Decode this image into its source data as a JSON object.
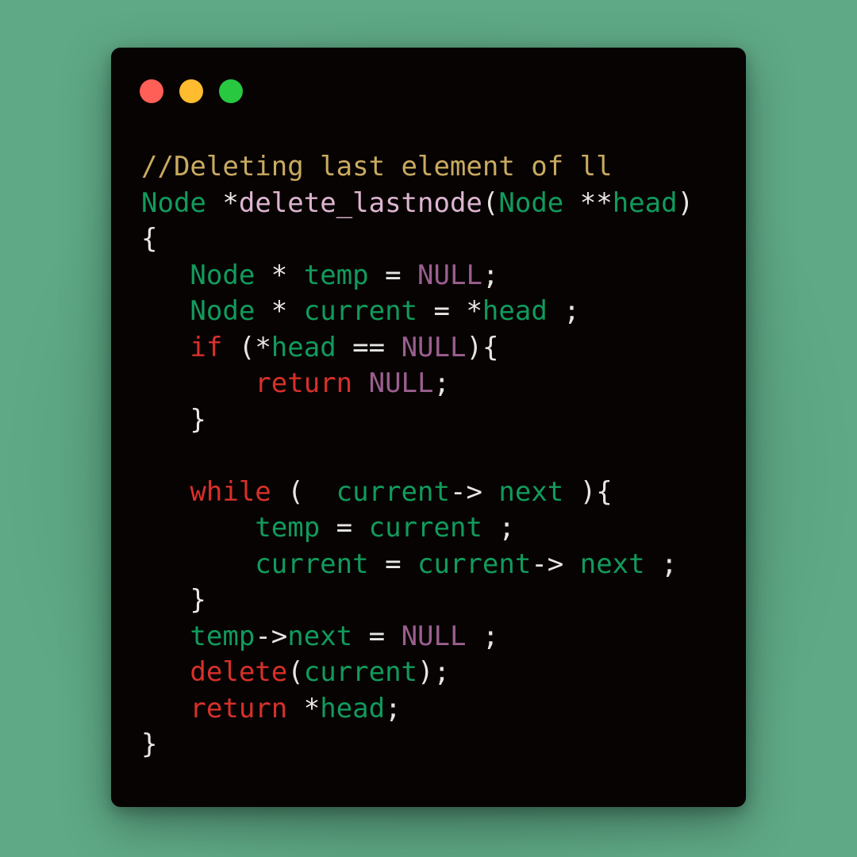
{
  "window": {
    "controls": [
      {
        "name": "close",
        "color": "#ff5f57"
      },
      {
        "name": "minimize",
        "color": "#febc2e"
      },
      {
        "name": "maximize",
        "color": "#28c840"
      }
    ]
  },
  "colors": {
    "background": "#5fa986",
    "editor_bg": "#070303",
    "comment": "#c9aa60",
    "type": "#119b5c",
    "function": "#ddb5d0",
    "keyword": "#d8302a",
    "null": "#9a5f8e",
    "default": "#e8e6e3"
  },
  "code": {
    "lines": [
      [
        {
          "t": "comment",
          "v": "//Deleting last element of ll"
        }
      ],
      [
        {
          "t": "type",
          "v": "Node"
        },
        {
          "t": "op",
          "v": " *"
        },
        {
          "t": "func",
          "v": "delete_lastnode"
        },
        {
          "t": "op",
          "v": "("
        },
        {
          "t": "type",
          "v": "Node"
        },
        {
          "t": "op",
          "v": " **"
        },
        {
          "t": "ident",
          "v": "head"
        },
        {
          "t": "op",
          "v": ")"
        }
      ],
      [
        {
          "t": "op",
          "v": "{"
        }
      ],
      [
        {
          "t": "op",
          "v": "   "
        },
        {
          "t": "type",
          "v": "Node"
        },
        {
          "t": "op",
          "v": " * "
        },
        {
          "t": "ident",
          "v": "temp"
        },
        {
          "t": "op",
          "v": " = "
        },
        {
          "t": "null",
          "v": "NULL"
        },
        {
          "t": "op",
          "v": ";"
        }
      ],
      [
        {
          "t": "op",
          "v": "   "
        },
        {
          "t": "type",
          "v": "Node"
        },
        {
          "t": "op",
          "v": " * "
        },
        {
          "t": "ident",
          "v": "current"
        },
        {
          "t": "op",
          "v": " = *"
        },
        {
          "t": "ident",
          "v": "head"
        },
        {
          "t": "op",
          "v": " ;"
        }
      ],
      [
        {
          "t": "op",
          "v": "   "
        },
        {
          "t": "kw",
          "v": "if"
        },
        {
          "t": "op",
          "v": " (*"
        },
        {
          "t": "ident",
          "v": "head"
        },
        {
          "t": "op",
          "v": " == "
        },
        {
          "t": "null",
          "v": "NULL"
        },
        {
          "t": "op",
          "v": "){"
        }
      ],
      [
        {
          "t": "op",
          "v": "       "
        },
        {
          "t": "kw",
          "v": "return"
        },
        {
          "t": "op",
          "v": " "
        },
        {
          "t": "null",
          "v": "NULL"
        },
        {
          "t": "op",
          "v": ";"
        }
      ],
      [
        {
          "t": "op",
          "v": "   }"
        }
      ],
      [
        {
          "t": "op",
          "v": ""
        }
      ],
      [
        {
          "t": "op",
          "v": "   "
        },
        {
          "t": "kw",
          "v": "while"
        },
        {
          "t": "op",
          "v": " (  "
        },
        {
          "t": "ident",
          "v": "current"
        },
        {
          "t": "op",
          "v": "-> "
        },
        {
          "t": "ident",
          "v": "next"
        },
        {
          "t": "op",
          "v": " ){"
        }
      ],
      [
        {
          "t": "op",
          "v": "       "
        },
        {
          "t": "ident",
          "v": "temp"
        },
        {
          "t": "op",
          "v": " = "
        },
        {
          "t": "ident",
          "v": "current"
        },
        {
          "t": "op",
          "v": " ;"
        }
      ],
      [
        {
          "t": "op",
          "v": "       "
        },
        {
          "t": "ident",
          "v": "current"
        },
        {
          "t": "op",
          "v": " = "
        },
        {
          "t": "ident",
          "v": "current"
        },
        {
          "t": "op",
          "v": "-> "
        },
        {
          "t": "ident",
          "v": "next"
        },
        {
          "t": "op",
          "v": " ;"
        }
      ],
      [
        {
          "t": "op",
          "v": "   }"
        }
      ],
      [
        {
          "t": "op",
          "v": "   "
        },
        {
          "t": "ident",
          "v": "temp"
        },
        {
          "t": "op",
          "v": "->"
        },
        {
          "t": "ident",
          "v": "next"
        },
        {
          "t": "op",
          "v": " = "
        },
        {
          "t": "null",
          "v": "NULL"
        },
        {
          "t": "op",
          "v": " ;"
        }
      ],
      [
        {
          "t": "op",
          "v": "   "
        },
        {
          "t": "kw",
          "v": "delete"
        },
        {
          "t": "op",
          "v": "("
        },
        {
          "t": "ident",
          "v": "current"
        },
        {
          "t": "op",
          "v": ");"
        }
      ],
      [
        {
          "t": "op",
          "v": "   "
        },
        {
          "t": "kw",
          "v": "return"
        },
        {
          "t": "op",
          "v": " *"
        },
        {
          "t": "ident",
          "v": "head"
        },
        {
          "t": "op",
          "v": ";"
        }
      ],
      [
        {
          "t": "op",
          "v": "}"
        }
      ]
    ]
  }
}
